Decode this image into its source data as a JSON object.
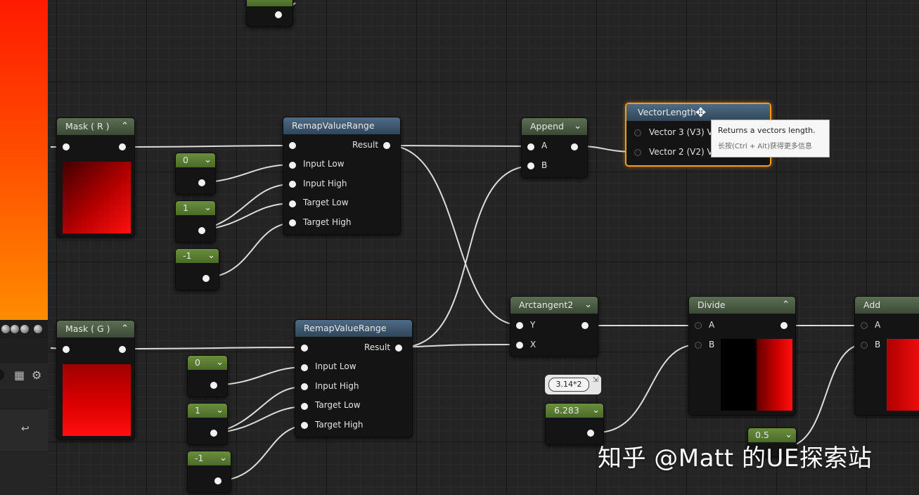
{
  "colors": {
    "accent": "#f59a1a",
    "const_header": "#5b7f33",
    "mask_header": "#4a5c44",
    "function_header": "#3e5870",
    "wire": "#d9d9d9"
  },
  "nodes": {
    "mask_r": {
      "title": "Mask ( R )"
    },
    "mask_g": {
      "title": "Mask ( G )"
    },
    "remap_1": {
      "title": "RemapValueRange",
      "output": "Result",
      "inputs": [
        "Input Low",
        "Input High",
        "Target Low",
        "Target High"
      ]
    },
    "remap_2": {
      "title": "RemapValueRange",
      "output": "Result",
      "inputs": [
        "Input Low",
        "Input High",
        "Target Low",
        "Target High"
      ]
    },
    "const_r_0": {
      "value": "0"
    },
    "const_r_1": {
      "value": "1"
    },
    "const_r_neg1": {
      "value": "-1"
    },
    "const_g_0": {
      "value": "0"
    },
    "const_g_1": {
      "value": "1"
    },
    "const_g_neg1": {
      "value": "-1"
    },
    "append": {
      "title": "Append",
      "inputs": [
        "A",
        "B"
      ]
    },
    "vector_length": {
      "title": "VectorLength",
      "inputs": [
        "Vector 3 (V3) V",
        "Vector 2 (V2) V"
      ]
    },
    "arctangent2": {
      "title": "Arctangent2",
      "inputs": [
        "Y",
        "X"
      ]
    },
    "divide": {
      "title": "Divide",
      "inputs": [
        "A",
        "B"
      ]
    },
    "add": {
      "title": "Add",
      "inputs": [
        "A",
        "B"
      ]
    },
    "const_6283": {
      "value": "6.283",
      "comment": "3.14*2"
    },
    "const_05": {
      "value": "0.5"
    }
  },
  "tooltip": {
    "line1": "Returns a vectors length.",
    "line2": "长按(Ctrl + Alt)获得更多信息"
  },
  "icons": {
    "panel": [
      "grid-icon",
      "gear-icon",
      "undo-icon"
    ],
    "cursor": "move-cursor-icon"
  },
  "watermark": "知乎 @Matt 的UE探索站"
}
